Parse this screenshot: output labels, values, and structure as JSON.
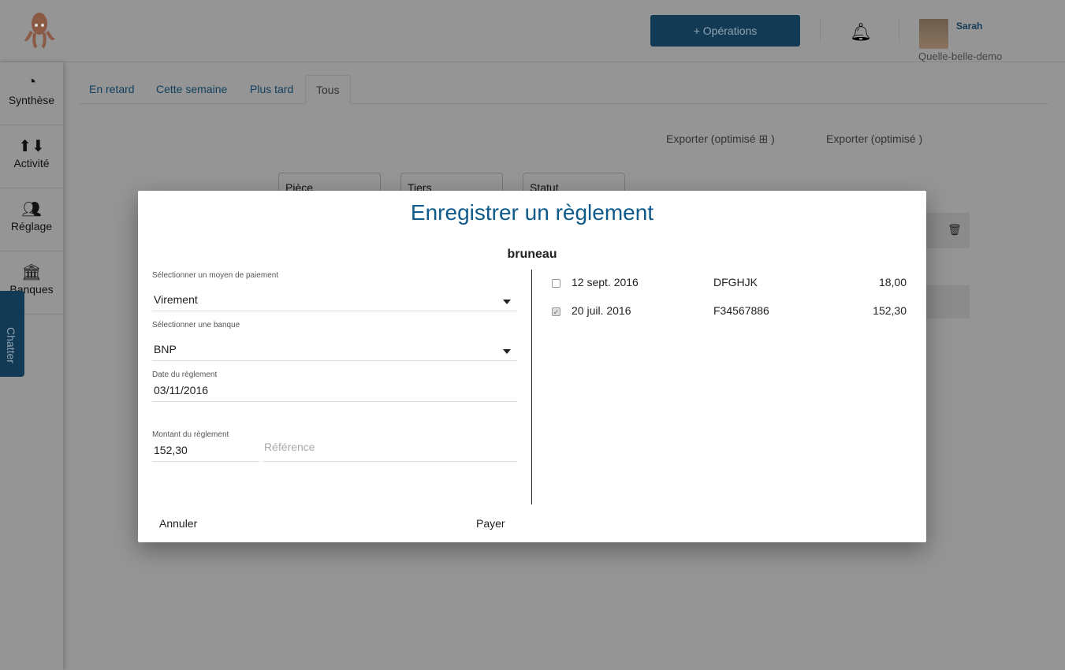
{
  "header": {
    "operations_label": "+ Opérations",
    "user_name": "Sarah",
    "user_org": "Quelle-belle-demo"
  },
  "sidebar": {
    "items": [
      {
        "label": "Synthèse",
        "icon": "pie-chart-icon"
      },
      {
        "label": "Activité",
        "icon": "arrows-icon"
      },
      {
        "label": "Réglage",
        "icon": "users-icon"
      },
      {
        "label": "Banques",
        "icon": "bank-icon"
      }
    ]
  },
  "chatter": {
    "label": "Chatter"
  },
  "tabs": [
    {
      "label": "En retard"
    },
    {
      "label": "Cette semaine"
    },
    {
      "label": "Plus tard"
    },
    {
      "label": "Tous",
      "active": true
    }
  ],
  "exports": [
    {
      "label": "Exporter (optimisé ⊞ )"
    },
    {
      "label": "Exporter (optimisé )"
    }
  ],
  "filters": [
    {
      "label": "Pièce"
    },
    {
      "label": "Tiers"
    },
    {
      "label": "Statut"
    }
  ],
  "modal": {
    "title": "Enregistrer un règlement",
    "client": "bruneau",
    "payment_method_label": "Sélectionner un moyen de paiement",
    "payment_method_value": "Virement",
    "bank_label": "Sélectionner une banque",
    "bank_value": "BNP",
    "date_label": "Date du règlement",
    "date_value": "03/11/2016",
    "amount_label": "Montant du règlement",
    "amount_value": "152,30",
    "reference_placeholder": "Référence",
    "cancel_label": "Annuler",
    "pay_label": "Payer",
    "invoices": [
      {
        "date": "12 sept. 2016",
        "ref": "DFGHJK",
        "amount": "18,00",
        "checked": false
      },
      {
        "date": "20 juil. 2016",
        "ref": "F34567886",
        "amount": "152,30",
        "checked": true
      }
    ]
  },
  "colors": {
    "accent": "#0e5a8a",
    "button": "#1c5a84"
  }
}
